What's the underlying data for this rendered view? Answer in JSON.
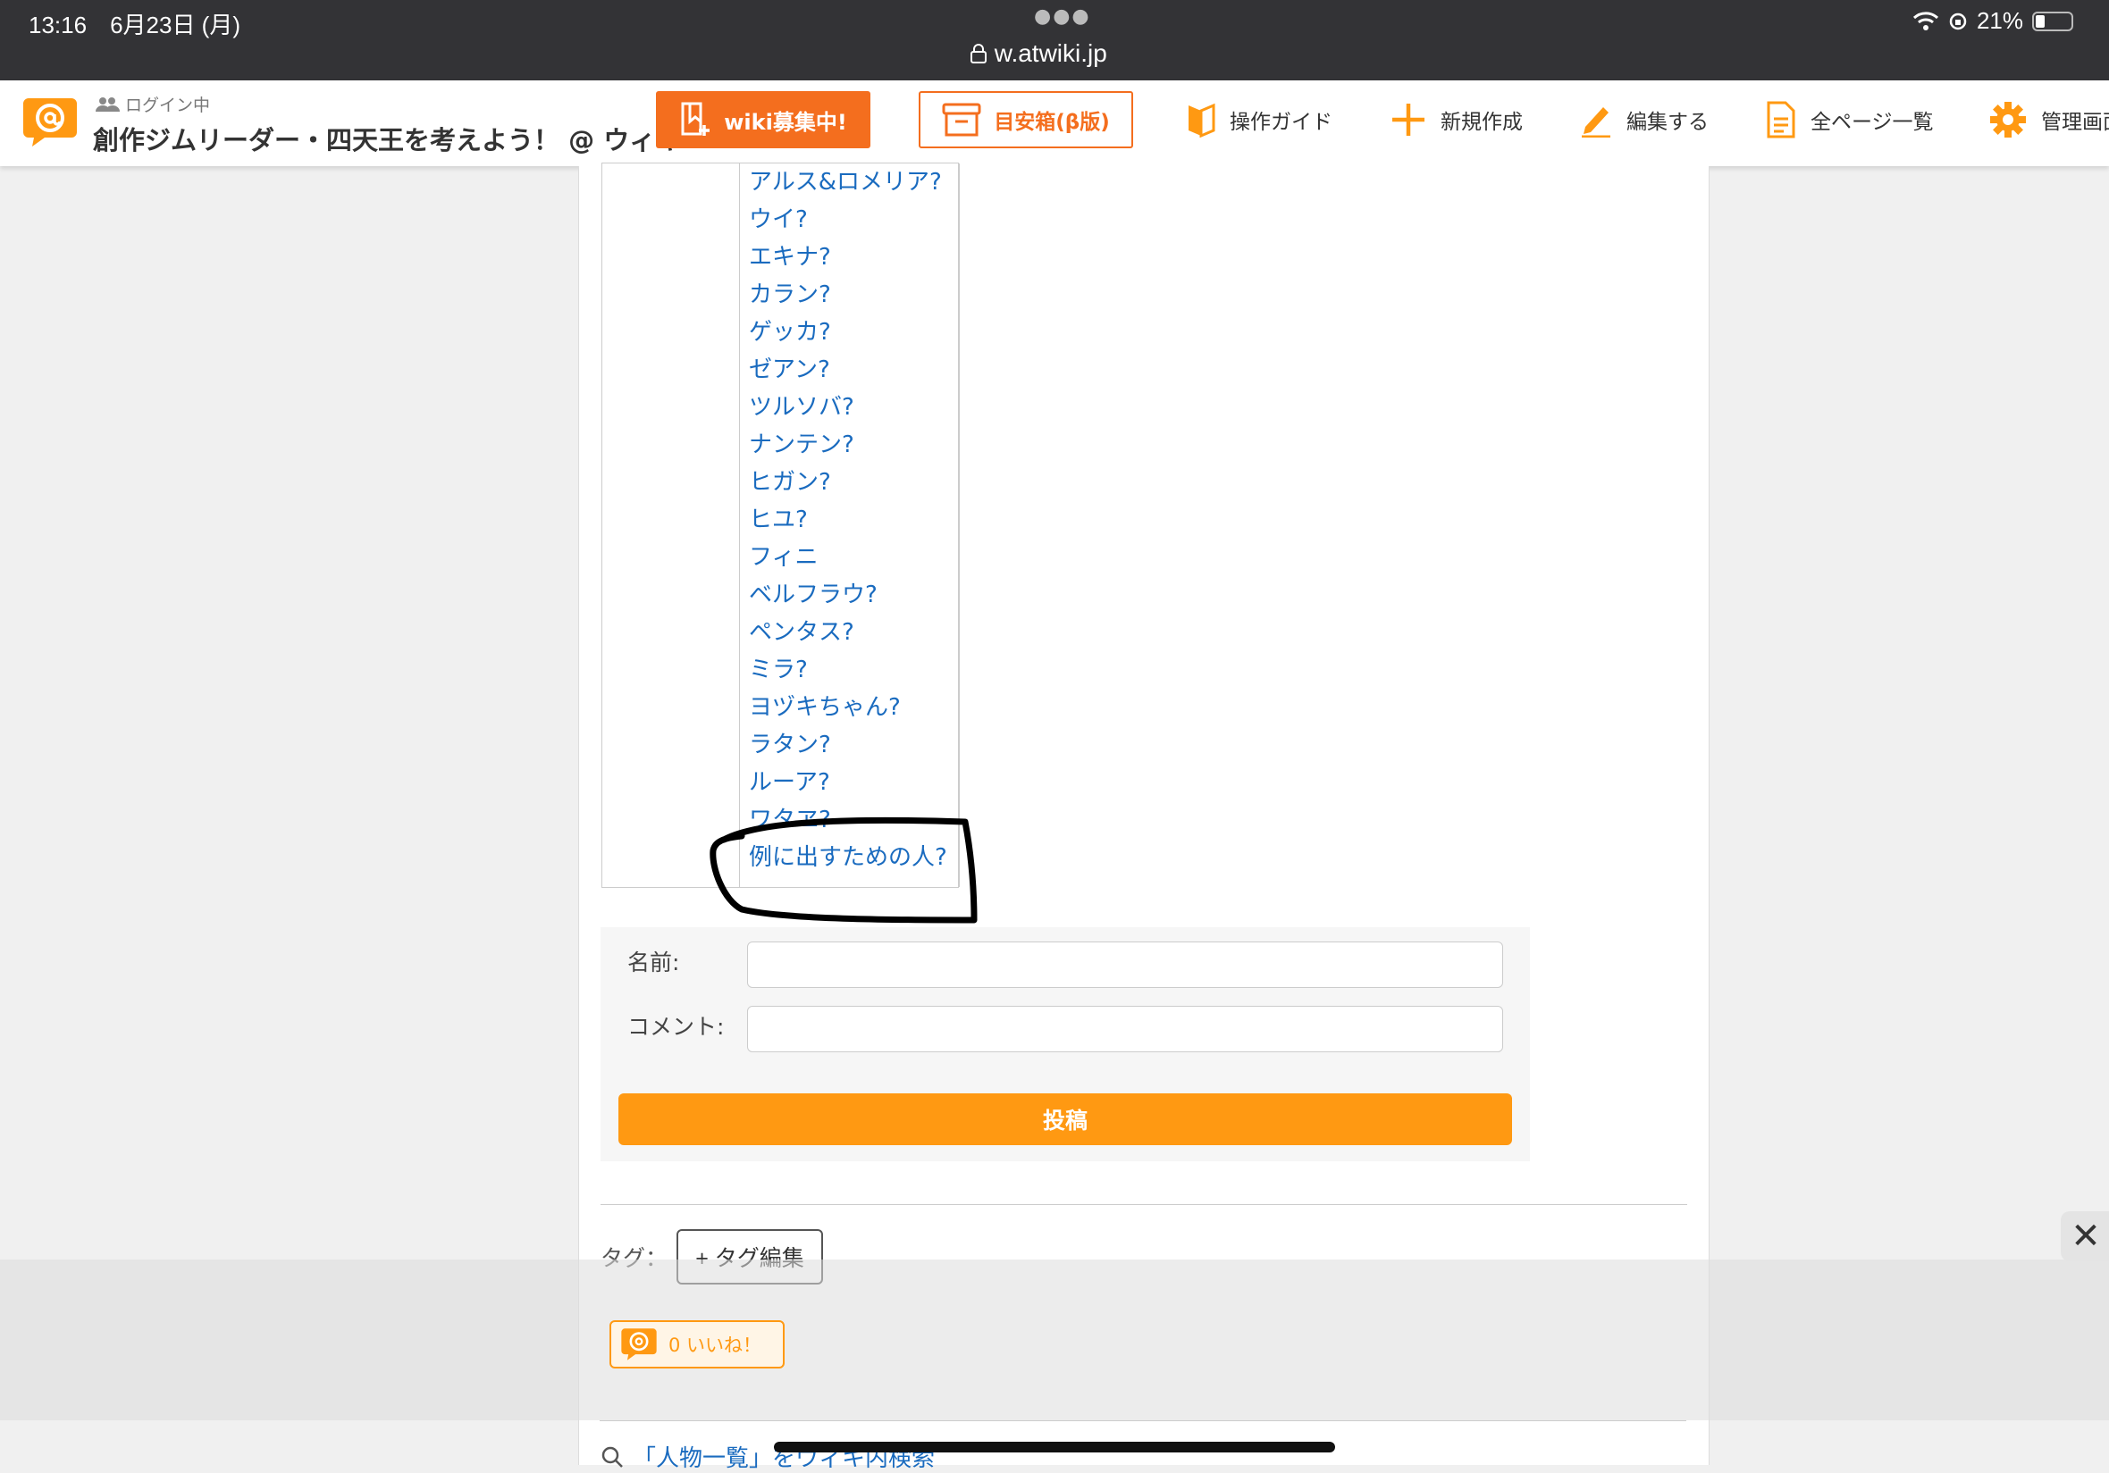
{
  "statusbar": {
    "time": "13:16　6月23日 (月)",
    "url": "w.atwiki.jp",
    "battery": "21%"
  },
  "header": {
    "login": "ログイン中",
    "title": "創作ジムリーダー・四天王を考えよう！ @ ウィキ",
    "recruit": "wiki募集中!",
    "box": "目安箱(β版)",
    "nav": {
      "guide": "操作ガイド",
      "new": "新規作成",
      "edit": "編集する",
      "all": "全ページ一覧",
      "admin": "管理画面"
    }
  },
  "list": [
    "アルス&ロメリア?",
    "ウイ?",
    "エキナ?",
    "カラン?",
    "ゲッカ?",
    "ゼアン?",
    "ツルソバ?",
    "ナンテン?",
    "ヒガン?",
    "ヒユ?",
    "フィニ",
    "ベルフラウ?",
    "ペンタス?",
    "ミラ?",
    "ヨヅキちゃん?",
    "ラタン?",
    "ルーア?",
    "ワタヱ?",
    "例に出すための人?"
  ],
  "form": {
    "name_label": "名前:",
    "comment_label": "コメント:",
    "post": "投稿"
  },
  "tags": {
    "label": "タグ：",
    "edit": "+ タグ編集"
  },
  "like": "0 いいね！",
  "search_link": "「人物一覧」をウィキ内検索",
  "colors": {
    "accent": "#ff9912",
    "recruit": "#f46e1e",
    "link": "#1a6bbf"
  }
}
